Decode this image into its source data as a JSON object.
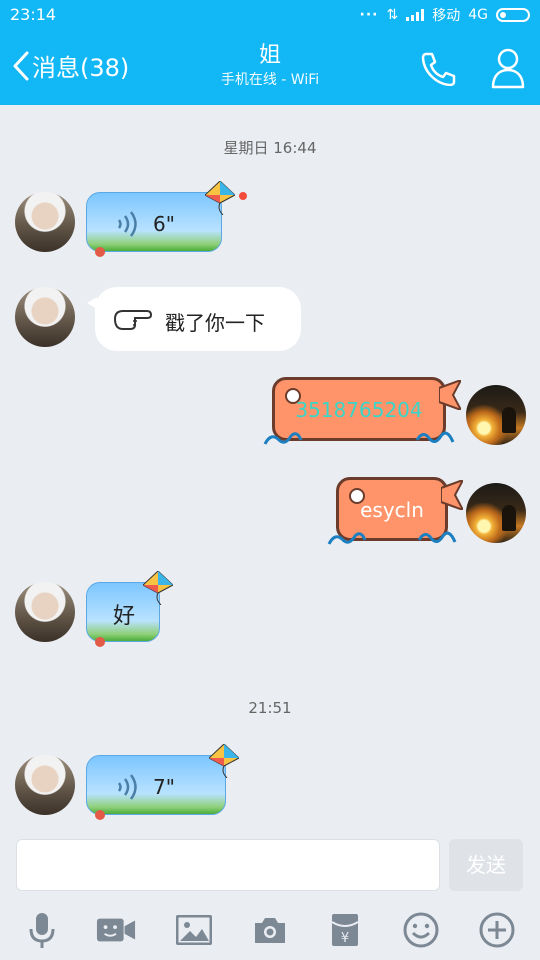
{
  "status_bar": {
    "time": "23:14",
    "carrier": "移动",
    "network": "4G"
  },
  "nav": {
    "back_label": "消息(38)",
    "title": "姐",
    "subtitle": "手机在线 - WiFi"
  },
  "messages": {
    "ts1": "星期日 16:44",
    "voice1_duration": "6\"",
    "poke_text": "戳了你一下",
    "sent1": "3518765204",
    "sent2": "esycln",
    "reply": "好",
    "ts2": "21:51",
    "voice2_duration": "7\""
  },
  "input": {
    "placeholder": "",
    "send_label": "发送"
  },
  "toolbar": {
    "icons": [
      "mic-icon",
      "video-icon",
      "image-icon",
      "camera-icon",
      "red-packet-icon",
      "emoji-icon",
      "plus-icon"
    ]
  },
  "colors": {
    "accent": "#12b7f5",
    "background": "#eaedf2",
    "unread": "#f24c3d",
    "fish_bubble": "#ff946a"
  }
}
